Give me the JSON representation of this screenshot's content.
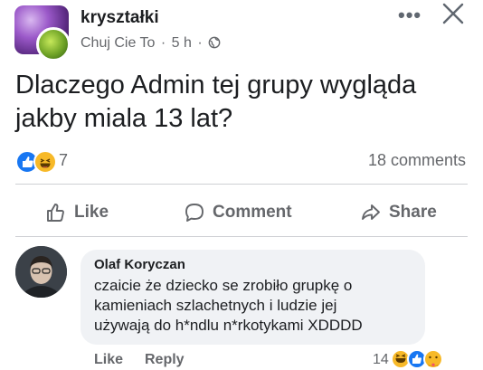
{
  "post": {
    "group_name": "kryształki",
    "author": "Chuj Cie To",
    "separator": "·",
    "time": "5 h",
    "text_line1": "Dlaczego Admin tej grupy wygląda",
    "text_line2": "jakby miala 13 lat?",
    "reaction_count": "7",
    "comments_count": "18 comments",
    "reaction_types": [
      "like",
      "haha"
    ]
  },
  "actions": {
    "like": "Like",
    "comment": "Comment",
    "share": "Share"
  },
  "comment": {
    "author": "Olaf Koryczan",
    "line1": "czaicie że dziecko se zrobiło grupkę o",
    "line2": "kamieniach szlachetnych i ludzie jej",
    "line3": "używają do h*ndlu n*rkotykami XDDDD",
    "like_label": "Like",
    "reply_label": "Reply",
    "reaction_count": "14",
    "reaction_types": [
      "haha",
      "like",
      "care"
    ]
  },
  "colors": {
    "like_blue": "#1877f2",
    "haha_yellow": "#f7b928",
    "secondary_text": "#65676b",
    "bubble_bg": "#f0f2f5"
  }
}
